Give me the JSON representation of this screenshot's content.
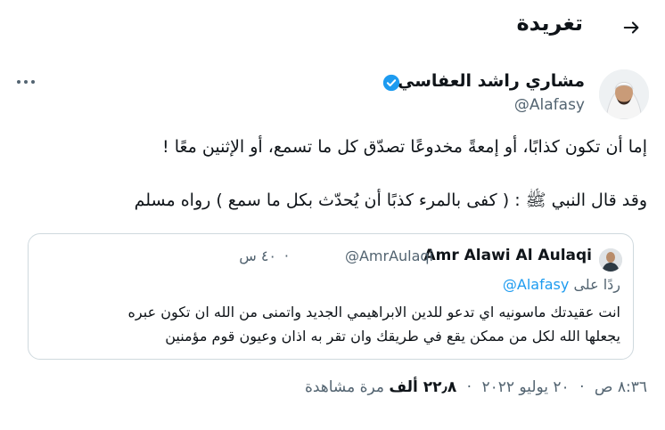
{
  "header": {
    "title": "تغريدة",
    "back_icon": "arrow-right-icon"
  },
  "author": {
    "name": "مشاري راشد العفاسي",
    "handle": "@Alafasy",
    "verified": true
  },
  "tweet": {
    "lines": [
      "إما أن تكون كذابًا، أو إمعةً مخدوعًا تصدّق كل ما تسمع، أو الإثنين معًا !",
      "",
      "وقد قال النبي ﷺ : ( كفى بالمرء كذبًا أن يُحدّث بكل ما سمع ) رواه مسلم"
    ]
  },
  "quote": {
    "name": "Amr Alawi Al Aulaqi",
    "handle": "@AmrAulaqi",
    "dot": "·",
    "time": "٤٠ س",
    "reply_prefix": "ردًا على",
    "reply_mention": "@Alafasy",
    "lines": [
      "انت عقيدتك ماسونيه اي تدعو للدين الابراهيمي الجديد واتمنى من الله ان تكون عبره",
      "يجعلها الله لكل من ممكن يقع في طريقك وان تقر به اذان وعيون قوم مؤمنين"
    ]
  },
  "meta": {
    "time": "٨:٣٦ ص",
    "sep1": "·",
    "date": "٢٠ يوليو ٢٠٢٢",
    "sep2": "·",
    "views_count": "٢٢٫٨ ألف",
    "views_label": "مرة مشاهدة"
  },
  "colors": {
    "accent": "#1d9bf0",
    "muted": "#536471",
    "text": "#0f1419",
    "border": "#cfd9de"
  }
}
